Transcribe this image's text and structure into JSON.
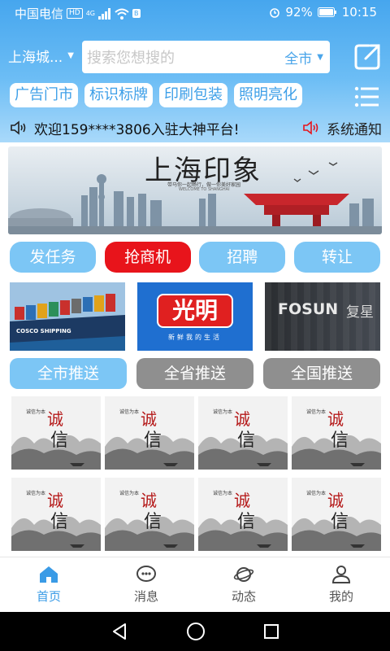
{
  "status": {
    "carrier": "中国电信",
    "hd_badge": "HD",
    "net_badge": "4G",
    "extra_badge": "B",
    "battery_pct": "92%",
    "time": "10:15"
  },
  "header": {
    "city": "上海城...",
    "search_placeholder": "搜索您想搜的",
    "search_scope": "全市"
  },
  "chips": [
    "广告门市",
    "标识标牌",
    "印刷包装",
    "照明亮化"
  ],
  "notice": {
    "message": "欢迎159****3806入驻大神平台!",
    "system_label": "系统通知"
  },
  "banner": {
    "title": "上海印象",
    "subtitle": "带马你一起畅行，做一你美好家园",
    "tagline": "WELCOME TO SHANGHAI"
  },
  "actions": [
    "发任务",
    "抢商机",
    "招聘",
    "转让"
  ],
  "ads": {
    "ad1_text": "COSCO SHIPPING",
    "ad2_brand": "光明",
    "ad2_slogan": "新鲜我的生活",
    "ad3_brand": "FOSUN",
    "ad3_cn": "复星"
  },
  "push_buttons": [
    "全市推送",
    "全省推送",
    "全国推送"
  ],
  "tiles": [
    {
      "small": "诚信为本",
      "big1": "诚",
      "big2": "信"
    },
    {
      "small": "诚信为本",
      "big1": "诚",
      "big2": "信"
    },
    {
      "small": "诚信为本",
      "big1": "诚",
      "big2": "信"
    },
    {
      "small": "诚信为本",
      "big1": "诚",
      "big2": "信"
    },
    {
      "small": "诚信为本",
      "big1": "诚",
      "big2": "信"
    },
    {
      "small": "诚信为本",
      "big1": "诚",
      "big2": "信"
    },
    {
      "small": "诚信为本",
      "big1": "诚",
      "big2": "信"
    },
    {
      "small": "诚信为本",
      "big1": "诚",
      "big2": "信"
    }
  ],
  "tabs": [
    {
      "label": "首页",
      "icon": "home-icon"
    },
    {
      "label": "消息",
      "icon": "message-icon"
    },
    {
      "label": "动态",
      "icon": "planet-icon"
    },
    {
      "label": "我的",
      "icon": "profile-icon"
    }
  ],
  "colors": {
    "accent": "#3a9be6",
    "header_top": "#46a6ee",
    "active_red": "#e8141b",
    "button_blue": "#7cc6f5",
    "button_grey": "#8f8f8f"
  }
}
